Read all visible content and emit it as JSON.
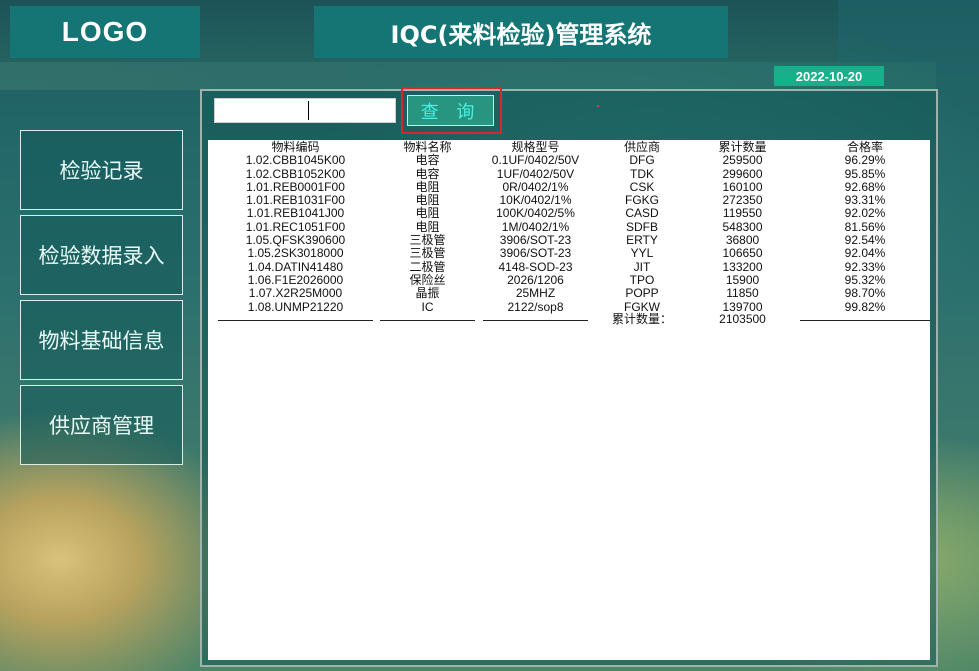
{
  "header": {
    "logo": "LOGO",
    "title": "IQC(来料检验)管理系统",
    "date": "2022-10-20"
  },
  "sidebar": {
    "items": [
      {
        "label": "检验记录"
      },
      {
        "label": "检验数据录入"
      },
      {
        "label": "物料基础信息"
      },
      {
        "label": "供应商管理"
      }
    ]
  },
  "search": {
    "value": "",
    "button_label": "查 询"
  },
  "table": {
    "headers": [
      "物料编码",
      "物料名称",
      "规格型号",
      "供应商",
      "累计数量",
      "合格率"
    ],
    "rows": [
      [
        "1.02.CBB1045K00",
        "电容",
        "0.1UF/0402/50V",
        "DFG",
        "259500",
        "96.29%"
      ],
      [
        "1.02.CBB1052K00",
        "电容",
        "1UF/0402/50V",
        "TDK",
        "299600",
        "95.85%"
      ],
      [
        "1.01.REB0001F00",
        "电阻",
        "0R/0402/1%",
        "CSK",
        "160100",
        "92.68%"
      ],
      [
        "1.01.REB1031F00",
        "电阻",
        "10K/0402/1%",
        "FGKG",
        "272350",
        "93.31%"
      ],
      [
        "1.01.REB1041J00",
        "电阻",
        "100K/0402/5%",
        "CASD",
        "119550",
        "92.02%"
      ],
      [
        "1.01.REC1051F00",
        "电阻",
        "1M/0402/1%",
        "SDFB",
        "548300",
        "81.56%"
      ],
      [
        "1.05.QFSK390600",
        "三极管",
        "3906/SOT-23",
        "ERTY",
        "36800",
        "92.54%"
      ],
      [
        "1.05.2SK3018000",
        "三极管",
        "3906/SOT-23",
        "YYL",
        "106650",
        "92.04%"
      ],
      [
        "1.04.DATIN41480",
        "二极管",
        "4148-SOD-23",
        "JIT",
        "133200",
        "92.33%"
      ],
      [
        "1.06.F1E2026000",
        "保险丝",
        "2026/1206",
        "TPO",
        "15900",
        "95.32%"
      ],
      [
        "1.07.X2R25M000",
        "晶振",
        "25MHZ",
        "POPP",
        "11850",
        "98.70%"
      ],
      [
        "1.08.UNMP21220",
        "IC",
        "2122/sop8",
        "FGKW",
        "139700",
        "99.82%"
      ]
    ],
    "total_label": "累计数量：",
    "total_value": "2103500"
  }
}
